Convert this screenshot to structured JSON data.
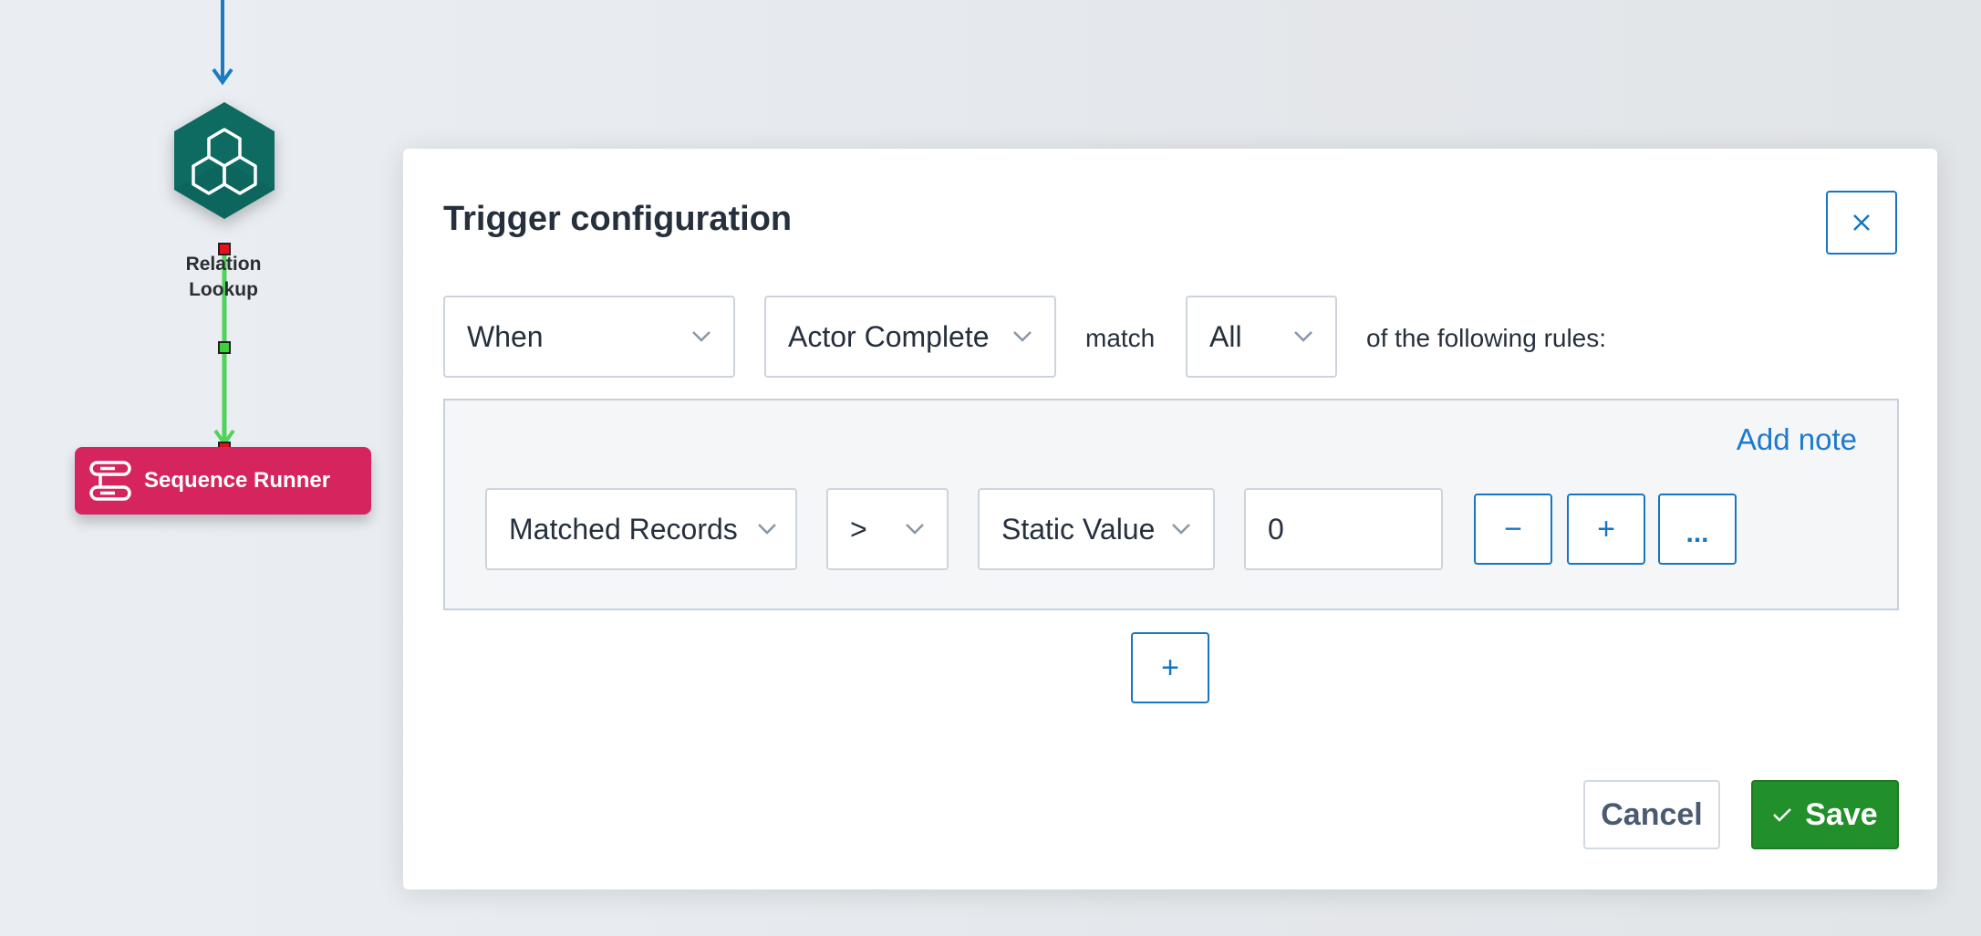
{
  "canvas": {
    "relation_node": {
      "label_line1": "Relation",
      "label_line2": "Lookup",
      "icon": "cubes-icon",
      "color": "#0e6b62"
    },
    "sequence_node": {
      "label": "Sequence Runner",
      "icon": "sequence-icon",
      "color": "#d5245e"
    },
    "connector_color": "#1a7ac2",
    "edge_color": "#4fd35a"
  },
  "modal": {
    "title": "Trigger configuration",
    "close_icon": "close-icon",
    "condition": {
      "when_value": "When",
      "event_value": "Actor Complete",
      "match_label": "match",
      "match_value": "All",
      "suffix": "of the following rules:"
    },
    "rules": {
      "add_note_label": "Add note",
      "items": [
        {
          "field": "Matched Records",
          "operator": ">",
          "value_type": "Static Value",
          "value": "0",
          "remove_label": "−",
          "add_label": "+",
          "more_label": "..."
        }
      ],
      "add_rule_label": "+"
    },
    "footer": {
      "cancel_label": "Cancel",
      "save_label": "Save"
    }
  }
}
